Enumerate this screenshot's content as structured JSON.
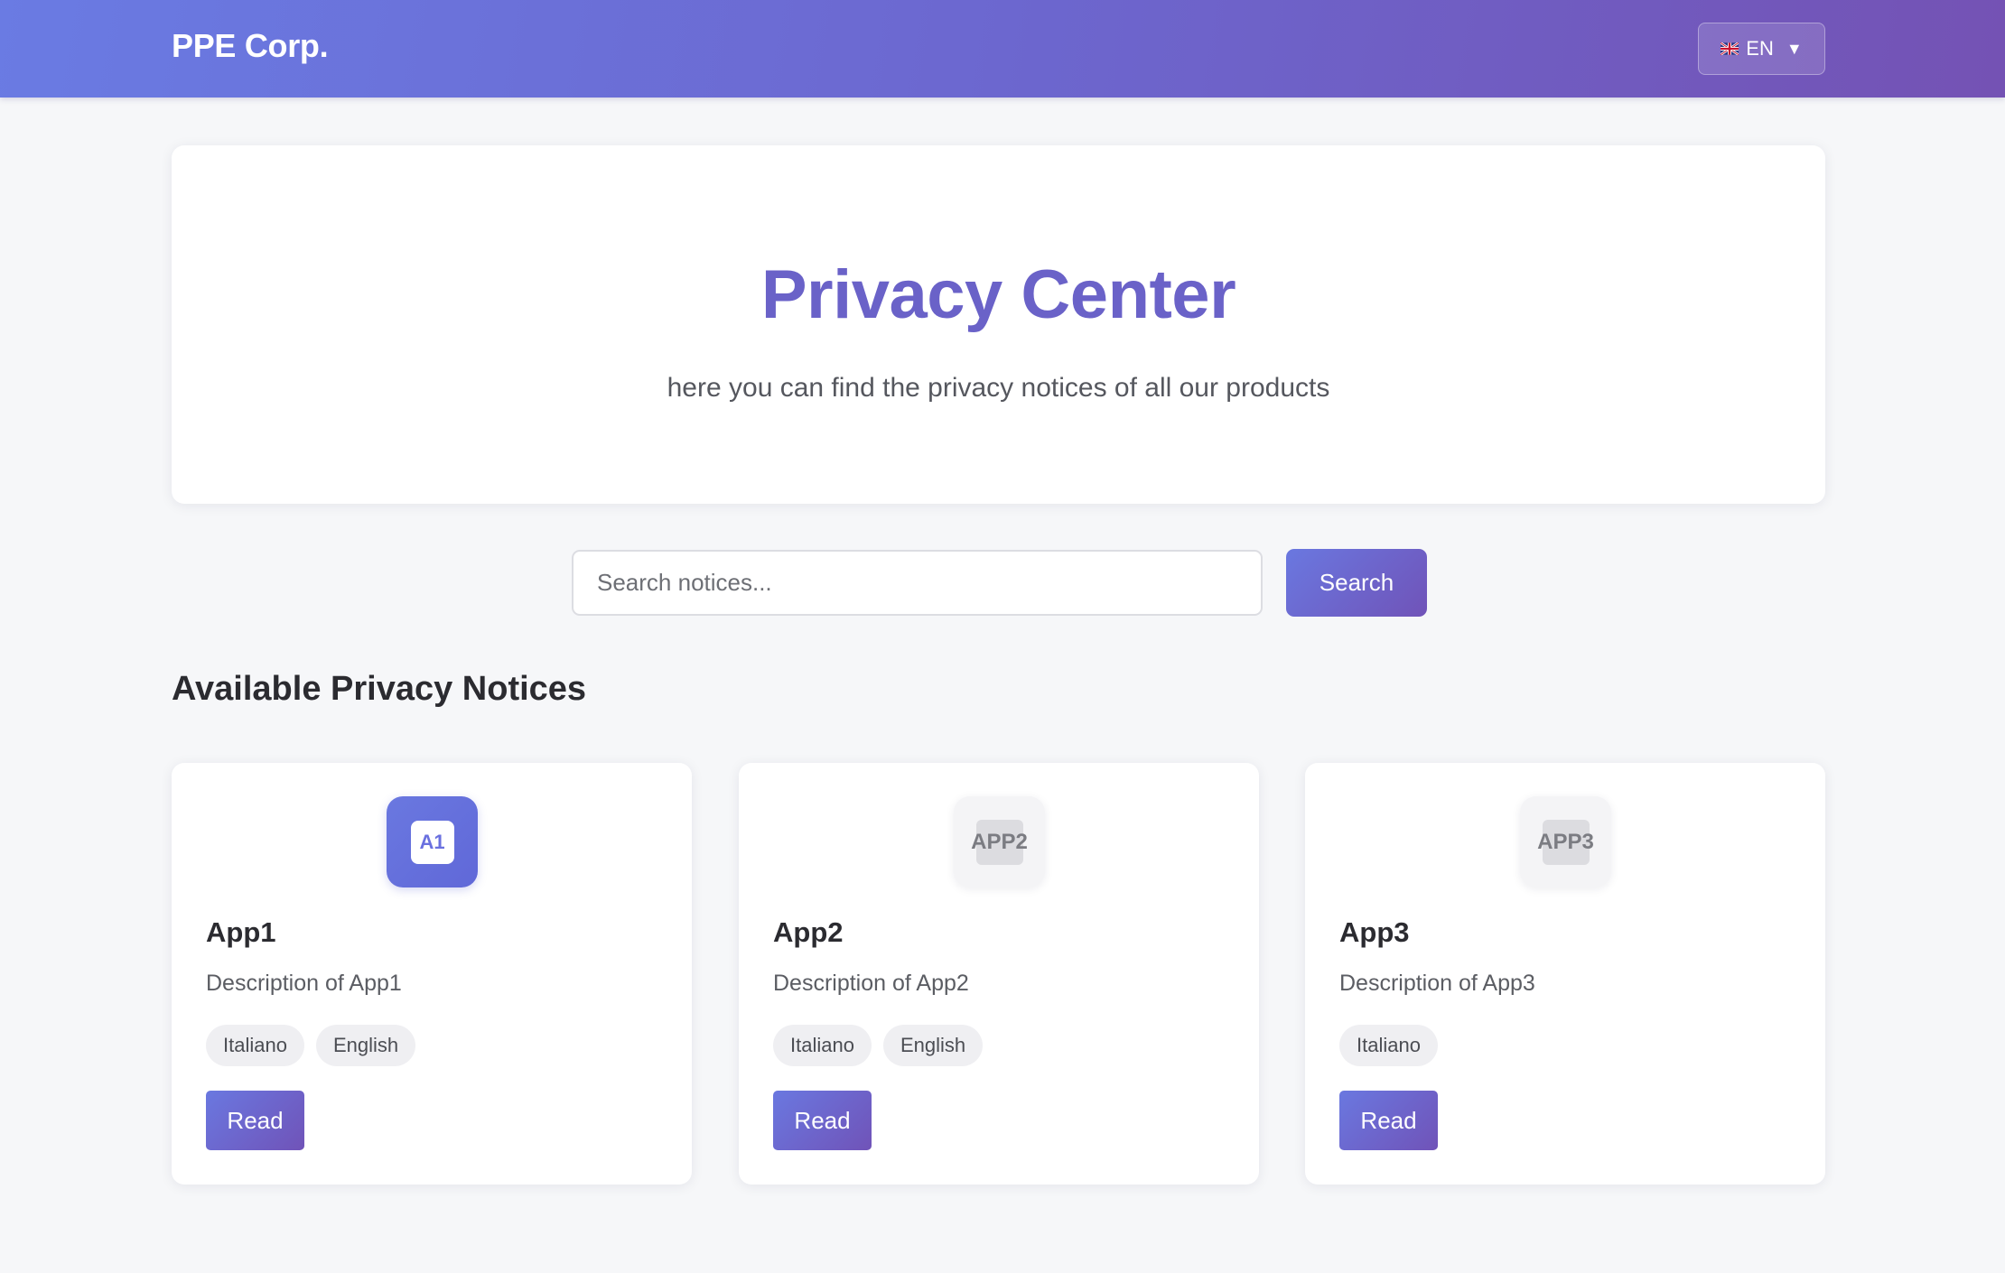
{
  "header": {
    "brand": "PPE Corp.",
    "language": {
      "flag_icon": "uk-flag-icon",
      "code": "EN",
      "chevron_icon": "chevron-down-icon"
    },
    "gradient": [
      "#6a7be3",
      "#7452b4"
    ]
  },
  "hero": {
    "title": "Privacy Center",
    "subtitle": "here you can find the privacy notices of all our products",
    "title_color": "#6a62c8"
  },
  "search": {
    "placeholder": "Search notices...",
    "value": "",
    "button_label": "Search"
  },
  "section": {
    "title": "Available Privacy Notices"
  },
  "apps": [
    {
      "icon_text": "A1",
      "icon_style": "primary",
      "name": "App1",
      "description": "Description of App1",
      "languages": [
        "Italiano",
        "English"
      ],
      "read_label": "Read"
    },
    {
      "icon_text": "APP2",
      "icon_style": "placeholder",
      "name": "App2",
      "description": "Description of App2",
      "languages": [
        "Italiano",
        "English"
      ],
      "read_label": "Read"
    },
    {
      "icon_text": "APP3",
      "icon_style": "placeholder",
      "name": "App3",
      "description": "Description of App3",
      "languages": [
        "Italiano"
      ],
      "read_label": "Read"
    }
  ]
}
